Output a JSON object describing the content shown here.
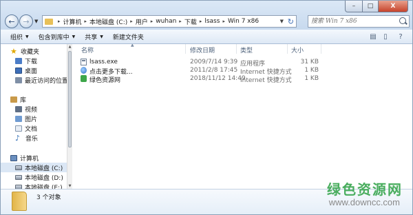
{
  "window": {
    "caption_buttons": {
      "minimize": "–",
      "maximize": "□",
      "close": "X"
    }
  },
  "nav": {
    "back_glyph": "←",
    "forward_glyph": "→"
  },
  "address": {
    "segments": [
      "计算机",
      "本地磁盘 (C:)",
      "用户",
      "wuhan",
      "下载",
      "lsass",
      "Win 7 x86"
    ]
  },
  "search": {
    "placeholder": "搜索 Win 7 x86"
  },
  "toolbar": {
    "organize": "组织",
    "include_in_library": "包含到库中",
    "share": "共享",
    "new_folder": "新建文件夹"
  },
  "sidebar": {
    "favorites": {
      "label": "收藏夹",
      "items": [
        {
          "label": "下载",
          "icon": "download-icon"
        },
        {
          "label": "桌面",
          "icon": "desktop-icon"
        },
        {
          "label": "最近访问的位置",
          "icon": "recent-icon"
        }
      ]
    },
    "libraries": {
      "label": "库",
      "items": [
        {
          "label": "视频",
          "icon": "video-icon"
        },
        {
          "label": "图片",
          "icon": "picture-icon"
        },
        {
          "label": "文档",
          "icon": "document-icon"
        },
        {
          "label": "音乐",
          "icon": "music-icon"
        }
      ]
    },
    "computer": {
      "label": "计算机",
      "items": [
        {
          "label": "本地磁盘 (C:)",
          "icon": "drive-icon",
          "selected": true
        },
        {
          "label": "本地磁盘 (D:)",
          "icon": "drive-icon"
        },
        {
          "label": "本地磁盘 (E:)",
          "icon": "drive-icon"
        }
      ]
    }
  },
  "columns": {
    "name": "名称",
    "date": "修改日期",
    "type": "类型",
    "size": "大小"
  },
  "files": [
    {
      "name": "lsass.exe",
      "date": "2009/7/14 9:39",
      "type": "应用程序",
      "size": "31 KB",
      "icon": "exe-icon"
    },
    {
      "name": "点击更多下载...",
      "date": "2011/2/8 17:45",
      "type": "Internet 快捷方式",
      "size": "1 KB",
      "icon": "internet-shortcut-icon"
    },
    {
      "name": "绿色资源网",
      "date": "2018/11/12 14:49",
      "type": "Internet 快捷方式",
      "size": "1 KB",
      "icon": "internet-shortcut-icon"
    }
  ],
  "status": {
    "item_count": "3 个对象"
  },
  "watermark": {
    "title": "绿色资源网",
    "url": "www.downcc.com"
  },
  "colors": {
    "selection": "#dbe7f5",
    "watermark_green": "#49ad5e",
    "folder_gold": "#e2b548"
  }
}
